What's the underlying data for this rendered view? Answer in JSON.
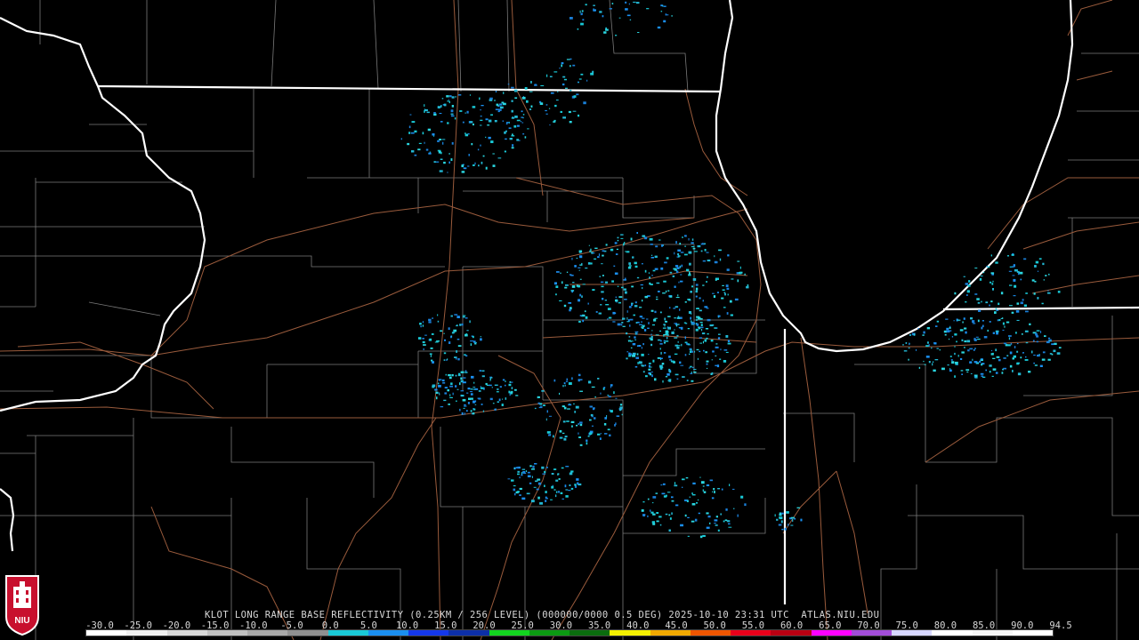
{
  "caption": "KLOT LONG RANGE BASE REFLECTIVITY (0.25KM / 256 LEVEL) (000000/0000 0.5 DEG) 2025-10-10 23:31 UTC  ATLAS.NIU.EDU",
  "scale_labels": [
    "-30.0",
    "-25.0",
    "-20.0",
    "-15.0",
    "-10.0",
    "-5.0",
    "0.0",
    "5.0",
    "10.0",
    "15.0",
    "20.0",
    "25.0",
    "30.0",
    "35.0",
    "40.0",
    "45.0",
    "50.0",
    "55.0",
    "60.0",
    "65.0",
    "70.0",
    "75.0",
    "80.0",
    "85.0",
    "90.0",
    "94.5"
  ],
  "colorbar_colors": [
    "#ffffff",
    "#f0f0f0",
    "#d8d8d8",
    "#c0c0c0",
    "#a8a8a8",
    "#909090",
    "#19c9d6",
    "#1a8ff0",
    "#1437ea",
    "#0c2fa8",
    "#12d41f",
    "#0b9a12",
    "#0a6c0e",
    "#f3f000",
    "#f0a900",
    "#ee5500",
    "#e8001a",
    "#b80012",
    "#ff00ff",
    "#a24dd8",
    "#d6d6ff",
    "#ffffff",
    "#f5f5f5",
    "#ffffff"
  ],
  "logo_text": "NIU"
}
